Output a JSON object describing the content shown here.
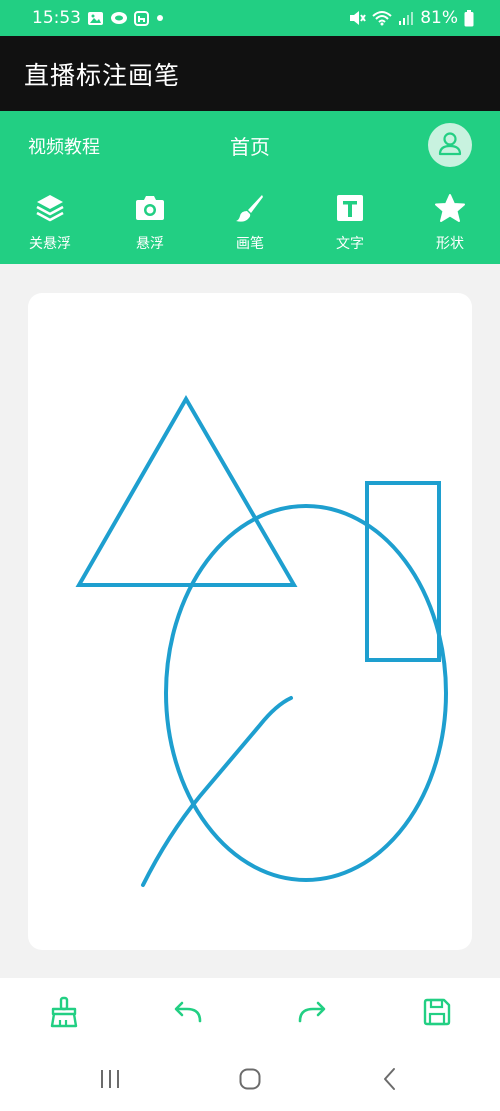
{
  "status_bar": {
    "time": "15:53",
    "battery": "81%",
    "left_icons": [
      "image-icon",
      "cloud-icon",
      "app-icon",
      "dot-icon"
    ],
    "right_icons": [
      "mute-icon",
      "wifi-icon",
      "signal-icon",
      "battery-icon"
    ]
  },
  "app": {
    "title": "直播标注画笔"
  },
  "header": {
    "tutorial": "视频教程",
    "title": "首页",
    "avatar_icon": "user-icon"
  },
  "tools": [
    {
      "label": "关悬浮",
      "icon": "layers-icon"
    },
    {
      "label": "悬浮",
      "icon": "camera-icon"
    },
    {
      "label": "画笔",
      "icon": "brush-icon"
    },
    {
      "label": "文字",
      "icon": "text-icon"
    },
    {
      "label": "形状",
      "icon": "star-icon"
    }
  ],
  "canvas": {
    "stroke_color": "#1e9fcf",
    "shapes": [
      "triangle",
      "ellipse",
      "rectangle",
      "freehand-line"
    ]
  },
  "bottom_toolbar": {
    "icons": [
      "broom-icon",
      "undo-icon",
      "redo-icon",
      "save-icon"
    ]
  },
  "colors": {
    "accent": "#22cf83",
    "title_bar": "#111111",
    "background": "#f2f2f2",
    "stroke": "#1e9fcf"
  }
}
